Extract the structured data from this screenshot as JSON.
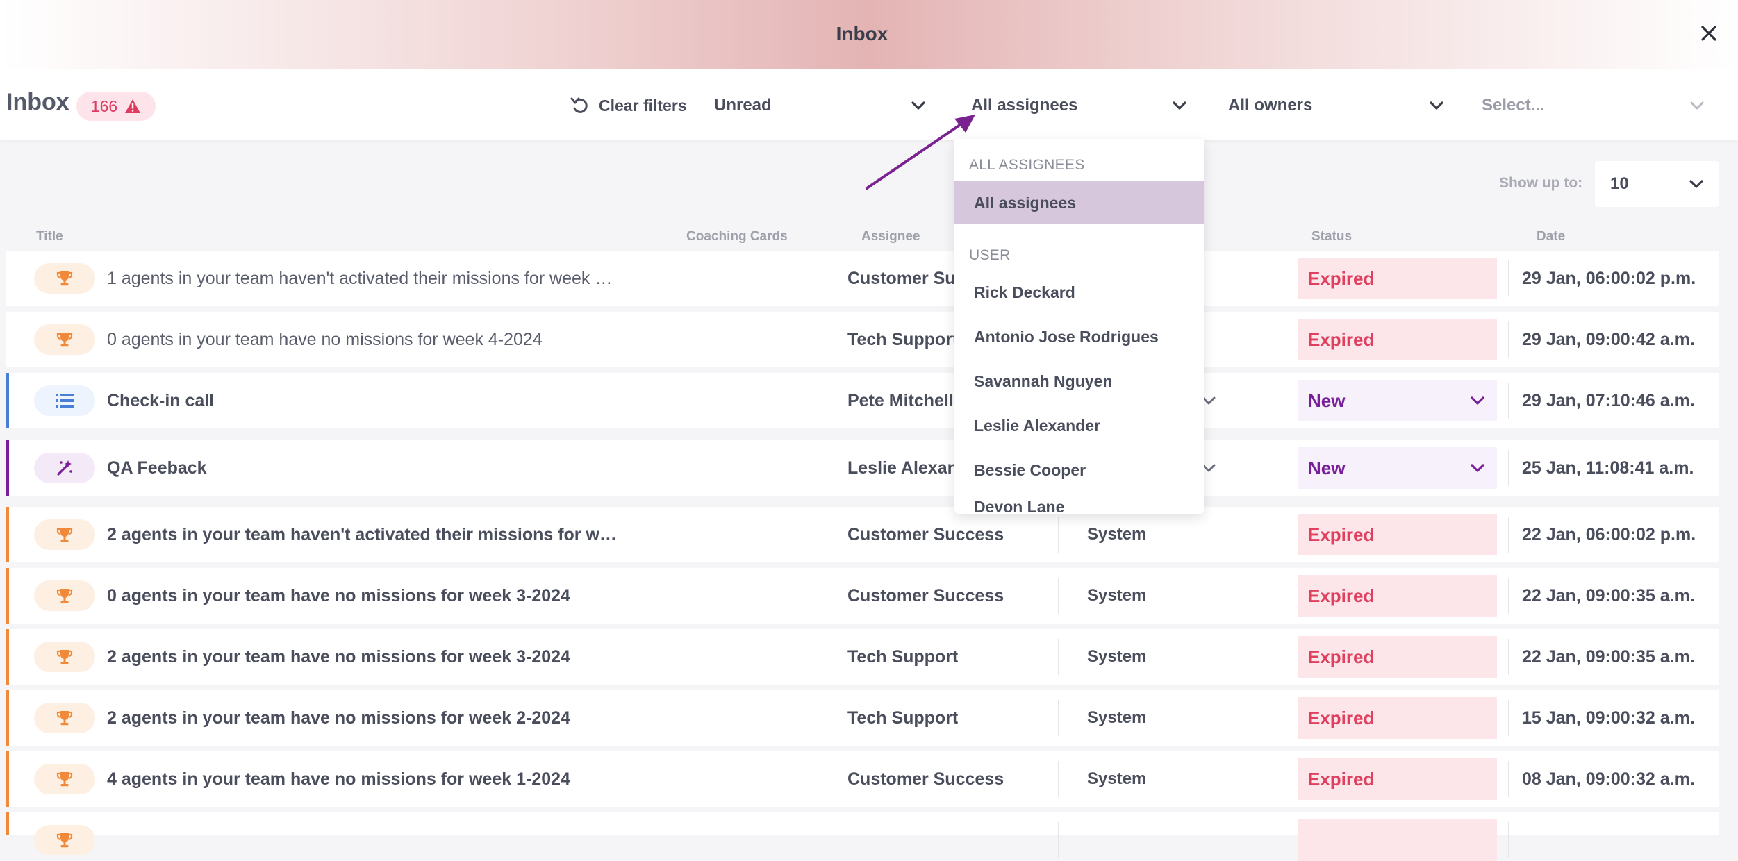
{
  "window": {
    "title": "Inbox",
    "close_icon": "close-icon"
  },
  "header": {
    "title": "Inbox",
    "count": "166",
    "count_icon": "warning-icon",
    "clear_filters": "Clear filters",
    "filters": {
      "read_state": "Unread",
      "assignees": "All assignees",
      "owners": "All owners",
      "select_placeholder": "Select..."
    }
  },
  "show_up_to": {
    "label": "Show up to:",
    "value": "10"
  },
  "columns": {
    "title": "Title",
    "coaching_cards": "Coaching Cards",
    "assignee": "Assignee",
    "status": "Status",
    "date": "Date"
  },
  "dropdown": {
    "group_all": "ALL ASSIGNEES",
    "all_option": "All assignees",
    "group_user": "USER",
    "users": [
      "Rick Deckard",
      "Antonio Jose Rodrigues",
      "Savannah Nguyen",
      "Leslie Alexander",
      "Bessie Cooper",
      "Devon Lane"
    ]
  },
  "colors": {
    "accent_purple": "#7a1f9a",
    "expired_bg": "#fde6ea",
    "expired_text": "#e0405f",
    "orange": "#f08a3a",
    "blue": "#4a7fd6"
  },
  "rows": [
    {
      "icon": "trophy-icon",
      "title": "1 agents in your team haven't activated their missions for week …",
      "assignee": "Customer Su",
      "owner": "",
      "status": "Expired",
      "date": "29 Jan, 06:00:02 p.m."
    },
    {
      "icon": "trophy-icon",
      "title": "0 agents in your team have no missions for week 4-2024",
      "assignee": "Tech Support",
      "owner": "",
      "status": "Expired",
      "date": "29 Jan, 09:00:42 a.m."
    },
    {
      "icon": "checklist-icon",
      "title": "Check-in call",
      "assignee": "Pete Mitchell",
      "owner": "",
      "status": "New",
      "date": "29 Jan, 07:10:46 a.m."
    },
    {
      "icon": "magic-wand-icon",
      "title": "QA Feeback",
      "assignee": "Leslie Alexan",
      "owner": "",
      "status": "New",
      "date": "25 Jan, 11:08:41 a.m."
    },
    {
      "icon": "trophy-icon",
      "title": "2 agents in your team haven't activated their missions for w…",
      "assignee": "Customer Success",
      "owner": "System",
      "status": "Expired",
      "date": "22 Jan, 06:00:02 p.m."
    },
    {
      "icon": "trophy-icon",
      "title": "0 agents in your team have no missions for week 3-2024",
      "assignee": "Customer Success",
      "owner": "System",
      "status": "Expired",
      "date": "22 Jan, 09:00:35 a.m."
    },
    {
      "icon": "trophy-icon",
      "title": "2 agents in your team have no missions for week 3-2024",
      "assignee": "Tech Support",
      "owner": "System",
      "status": "Expired",
      "date": "22 Jan, 09:00:35 a.m."
    },
    {
      "icon": "trophy-icon",
      "title": "2 agents in your team have no missions for week 2-2024",
      "assignee": "Tech Support",
      "owner": "System",
      "status": "Expired",
      "date": "15 Jan, 09:00:32 a.m."
    },
    {
      "icon": "trophy-icon",
      "title": "4 agents in your team have no missions for week 1-2024",
      "assignee": "Customer Success",
      "owner": "System",
      "status": "Expired",
      "date": "08 Jan, 09:00:32 a.m."
    },
    {
      "icon": "trophy-icon",
      "title": "",
      "assignee": "",
      "owner": "",
      "status": "",
      "date": ""
    }
  ]
}
